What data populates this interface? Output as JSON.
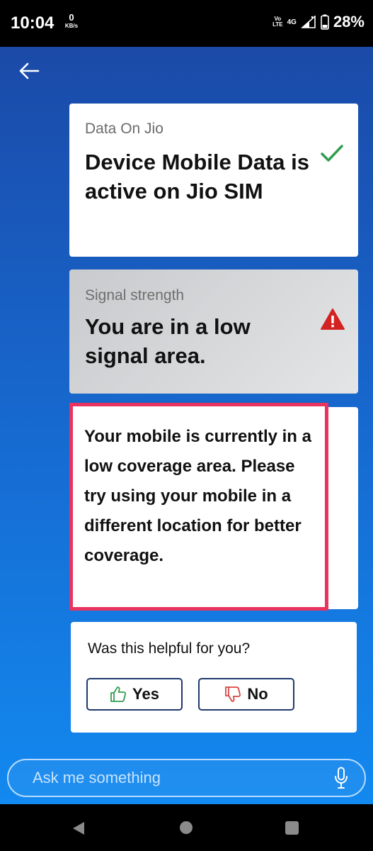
{
  "status_bar": {
    "time": "10:04",
    "speed_value": "0",
    "speed_unit": "KB/s",
    "volte_top": "Vo",
    "volte_bottom": "LTE",
    "network": "4G",
    "battery": "28%"
  },
  "cards": {
    "data": {
      "label": "Data On Jio",
      "title": "Device Mobile Data is active on Jio SIM",
      "status_icon": "check-icon",
      "status_color": "#2e9e4f"
    },
    "signal": {
      "label": "Signal strength",
      "title": "You are in a low signal area.",
      "status_icon": "warning-icon",
      "status_color": "#d32222"
    },
    "message": {
      "text": "Your mobile is currently in a low coverage area. Please try using your mobile in a different location for better coverage.",
      "highlight_color": "#e8345f"
    }
  },
  "feedback": {
    "question": "Was this helpful for you?",
    "yes_label": "Yes",
    "no_label": "No",
    "yes_icon": "thumbs-up-icon",
    "no_icon": "thumbs-down-icon"
  },
  "ask": {
    "placeholder": "Ask me something",
    "icon": "mic-icon"
  },
  "colors": {
    "gradient_top": "#1b4aa8",
    "gradient_bottom": "#1289f0",
    "button_border": "#1f3a6d"
  }
}
